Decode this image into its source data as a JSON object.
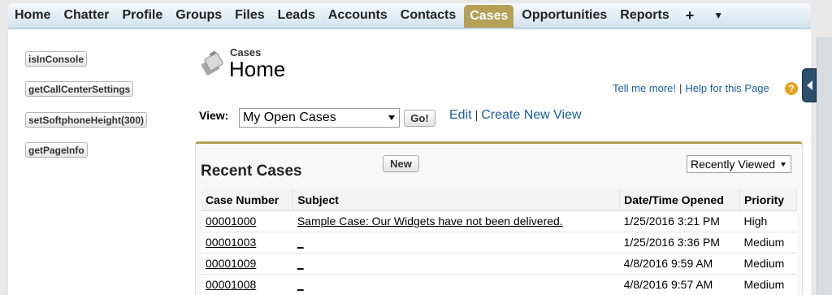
{
  "tabs": [
    {
      "label": "Home"
    },
    {
      "label": "Chatter"
    },
    {
      "label": "Profile"
    },
    {
      "label": "Groups"
    },
    {
      "label": "Files"
    },
    {
      "label": "Leads"
    },
    {
      "label": "Accounts"
    },
    {
      "label": "Contacts"
    },
    {
      "label": "Cases"
    },
    {
      "label": "Opportunities"
    },
    {
      "label": "Reports"
    },
    {
      "label": "+"
    },
    {
      "label": "▼"
    }
  ],
  "active_tab": "Cases",
  "api_buttons": [
    {
      "label": "isInConsole"
    },
    {
      "label": "getCallCenterSettings"
    },
    {
      "label": "setSoftphoneHeight(300)"
    },
    {
      "label": "getPageInfo"
    }
  ],
  "header": {
    "breadcrumb": "Cases",
    "title": "Home",
    "icon": "cases-icon"
  },
  "help": {
    "tell_me_more": "Tell me more!",
    "separator": "|",
    "help_page": "Help for this Page",
    "icon": "?"
  },
  "view": {
    "label": "View:",
    "selected": "My Open Cases",
    "go_label": "Go!",
    "edit_label": "Edit",
    "separator": "|",
    "create_label": "Create New View"
  },
  "recent": {
    "title": "Recent Cases",
    "new_label": "New",
    "filter_selected": "Recently Viewed",
    "columns": [
      "Case Number",
      "Subject",
      "Date/Time Opened",
      "Priority"
    ],
    "rows": [
      {
        "number": "00001000",
        "subject": "Sample Case: Our Widgets have not been delivered.",
        "opened": "1/25/2016 3:21 PM",
        "priority": "High"
      },
      {
        "number": "00001003",
        "subject": "_",
        "opened": "1/25/2016 3:36 PM",
        "priority": "Medium"
      },
      {
        "number": "00001009",
        "subject": "_",
        "opened": "4/8/2016 9:59 AM",
        "priority": "Medium"
      },
      {
        "number": "00001008",
        "subject": "_",
        "opened": "4/8/2016 9:57 AM",
        "priority": "Medium"
      }
    ]
  },
  "colors": {
    "active_tab": "#b5a055",
    "link": "#1a5e9c",
    "panel_accent": "#b5a055"
  }
}
